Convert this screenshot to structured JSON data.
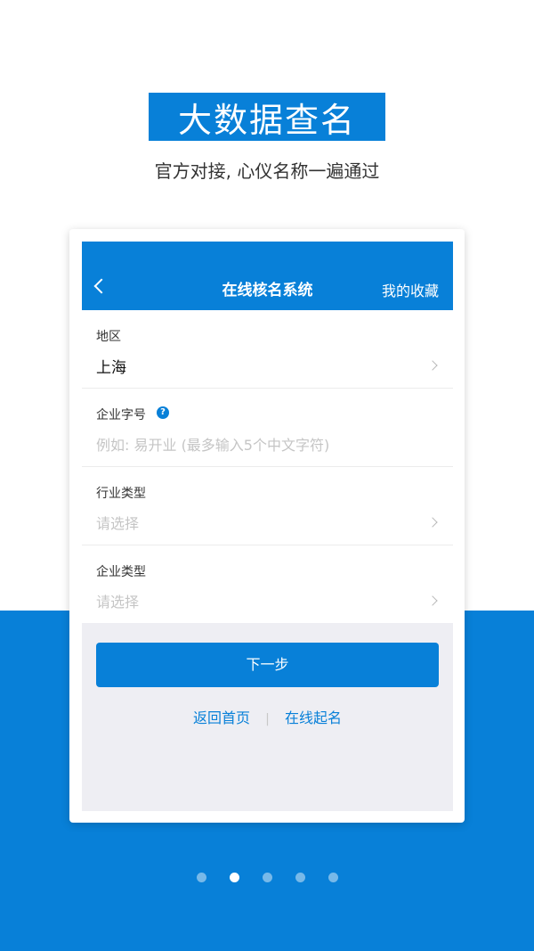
{
  "hero": {
    "title": "大数据查名",
    "subtitle": "官方对接, 心仪名称一遍通过"
  },
  "nav": {
    "back_icon": "chevron-left-icon",
    "title": "在线核名系统",
    "favorites_label": "我的收藏"
  },
  "form": {
    "region": {
      "label": "地区",
      "value": "上海"
    },
    "company_name": {
      "label": "企业字号",
      "placeholder": "例如: 易开业 (最多输入5个中文字符)",
      "help_icon": "question-icon"
    },
    "industry_type": {
      "label": "行业类型",
      "placeholder": "请选择"
    },
    "company_type": {
      "label": "企业类型",
      "placeholder": "请选择"
    }
  },
  "actions": {
    "next_label": "下一步",
    "home_link": "返回首页",
    "separator": "|",
    "naming_link": "在线起名"
  },
  "pager": {
    "count": 5,
    "active_index": 1
  },
  "colors": {
    "brand_blue": "#0880d8"
  }
}
